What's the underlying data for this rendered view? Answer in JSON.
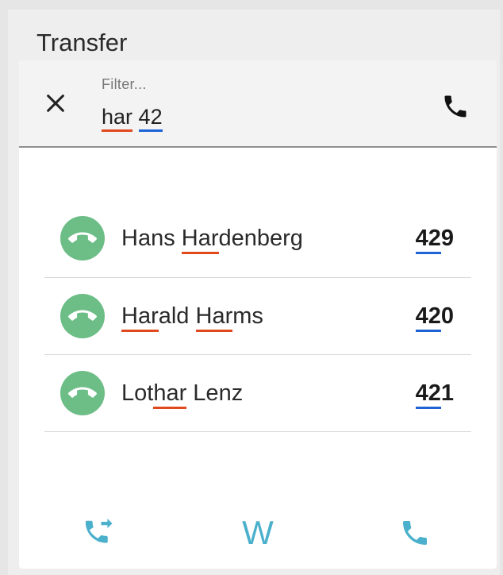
{
  "header": {
    "title": "Transfer"
  },
  "filter": {
    "label": "Filter...",
    "value_name_part": "har",
    "value_sep": " ",
    "value_number_part": "42"
  },
  "contacts": [
    {
      "name_pre": "Hans ",
      "name_m1": "Har",
      "name_mid": "denberg",
      "name_m2": "",
      "name_post": "",
      "ext_match": "42",
      "ext_rest": "9",
      "status": "available"
    },
    {
      "name_pre": "",
      "name_m1": "Har",
      "name_mid": "ald ",
      "name_m2": "Har",
      "name_post": "ms",
      "ext_match": "42",
      "ext_rest": "0",
      "status": "available"
    },
    {
      "name_pre": "Lot",
      "name_m1": "har",
      "name_mid": " Lenz",
      "name_m2": "",
      "name_post": "",
      "ext_match": "42",
      "ext_rest": "1",
      "status": "available"
    }
  ],
  "bottom_bar": {
    "transfer_icon": "call-transfer-icon",
    "w_label": "W",
    "call_icon": "phone-icon"
  },
  "colors": {
    "match_name_underline": "#e0481e",
    "match_number_underline": "#1e63d6",
    "available_status": "#6dbd87",
    "accent": "#4ab0cc"
  }
}
